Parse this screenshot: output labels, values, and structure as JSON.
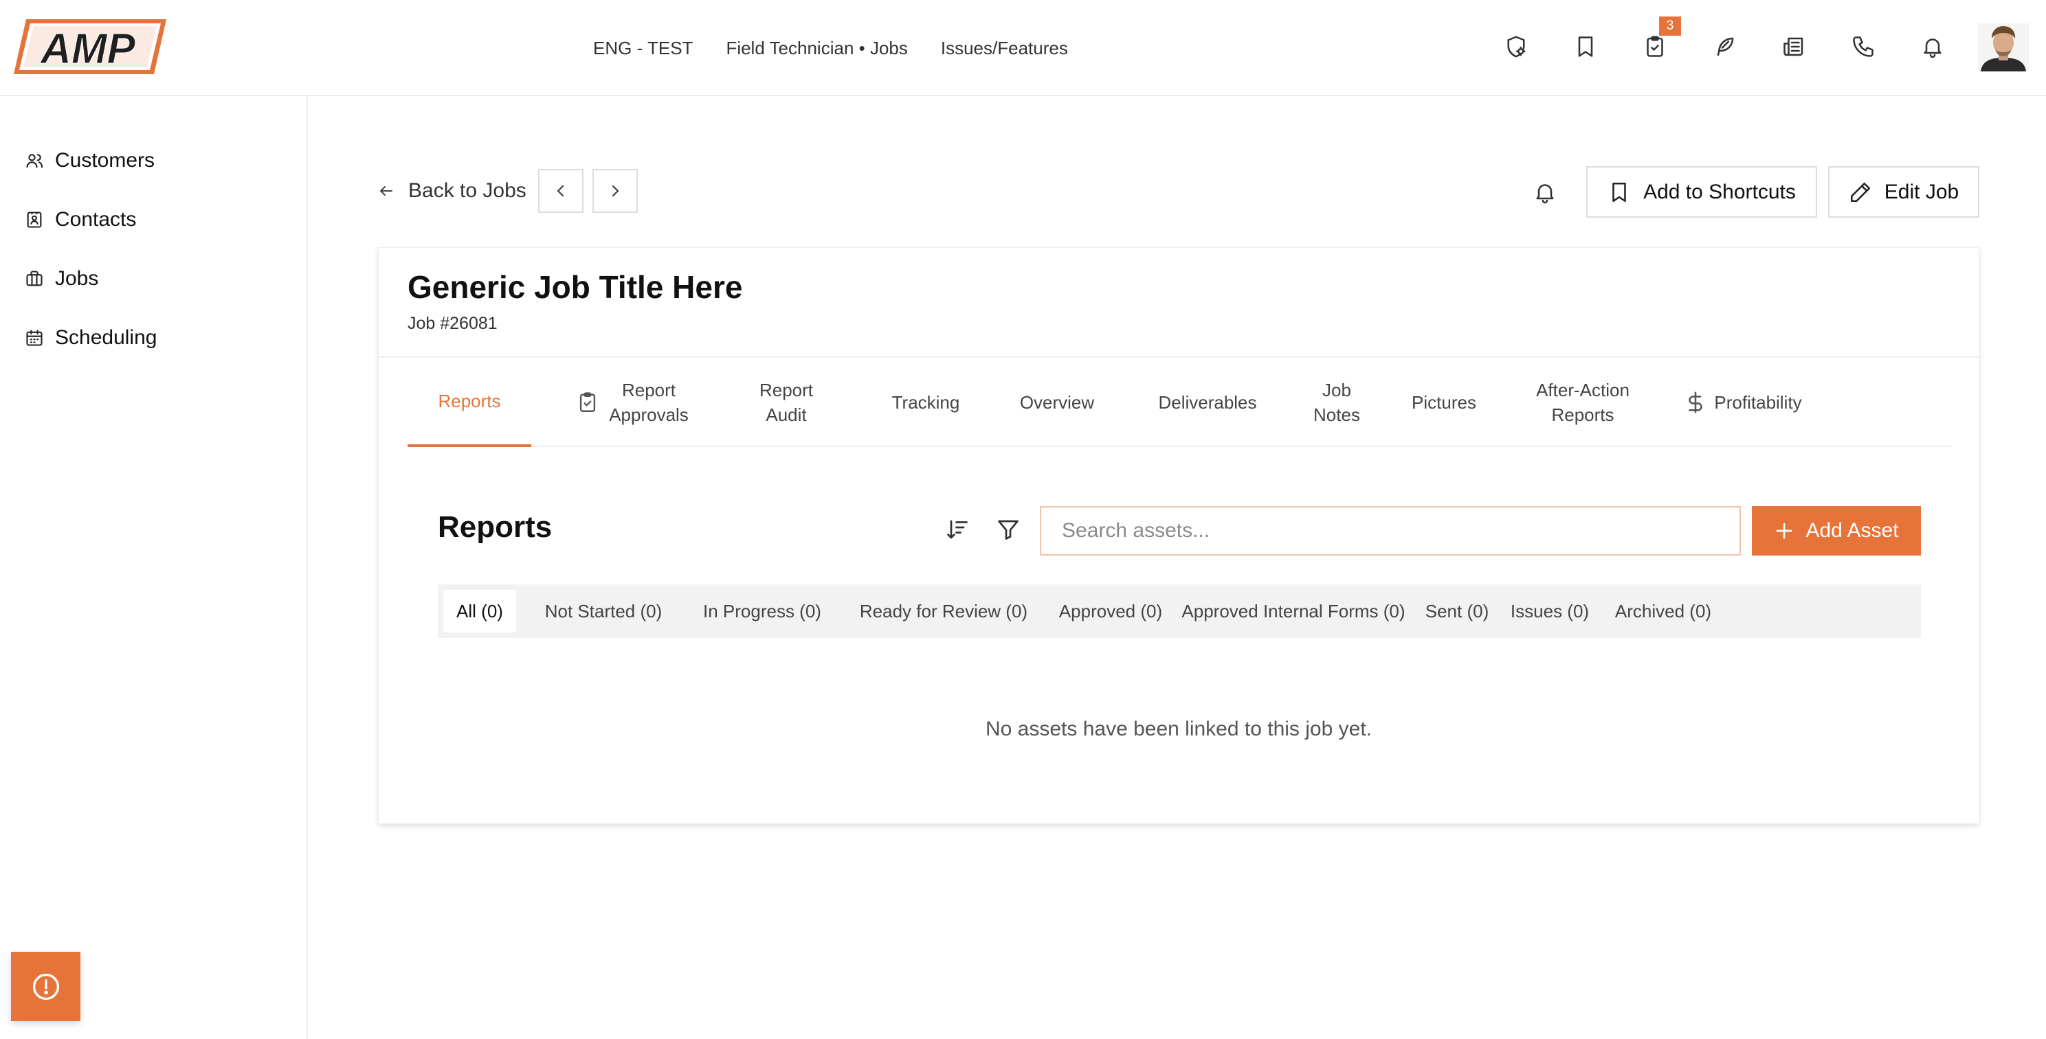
{
  "brand": {
    "logo_text": "AMP",
    "accent_color": "#e6743a"
  },
  "topnav": {
    "items": [
      "ENG - TEST",
      "Field Technician • Jobs",
      "Issues/Features"
    ]
  },
  "top_icons": {
    "items": [
      "shield-gear-icon",
      "bookmark-icon",
      "clipboard-check-icon",
      "feather-icon",
      "newspaper-icon",
      "phone-icon",
      "bell-icon"
    ],
    "task_badge_count": "3"
  },
  "sidebar": {
    "items": [
      {
        "label": "Customers",
        "icon": "users-icon"
      },
      {
        "label": "Contacts",
        "icon": "contact-card-icon"
      },
      {
        "label": "Jobs",
        "icon": "briefcase-icon"
      },
      {
        "label": "Scheduling",
        "icon": "calendar-icon"
      }
    ]
  },
  "header": {
    "back_label": "Back to Jobs",
    "shortcuts_label": "Add to Shortcuts",
    "edit_label": "Edit Job"
  },
  "job": {
    "title": "Generic Job Title Here",
    "number": "Job #26081"
  },
  "tabs": [
    {
      "line1": "Reports",
      "line2": "",
      "active": true
    },
    {
      "line1": "Report",
      "line2": "Approvals",
      "icon": "clipboard-check-icon"
    },
    {
      "line1": "Report",
      "line2": "Audit"
    },
    {
      "line1": "Tracking",
      "line2": ""
    },
    {
      "line1": "Overview",
      "line2": ""
    },
    {
      "line1": "Deliverables",
      "line2": ""
    },
    {
      "line1": "Job",
      "line2": "Notes"
    },
    {
      "line1": "Pictures",
      "line2": ""
    },
    {
      "line1": "After-Action",
      "line2": "Reports"
    },
    {
      "line1": "Profitability",
      "line2": "",
      "icon": "dollar-icon"
    }
  ],
  "reports": {
    "title": "Reports",
    "search_placeholder": "Search assets...",
    "search_value": "",
    "add_label": "Add Asset",
    "filters": [
      "All (0)",
      "Not Started (0)",
      "In Progress (0)",
      "Ready for Review (0)",
      "Approved (0)",
      "Approved Internal Forms (0)",
      "Sent (0)",
      "Issues (0)",
      "Archived (0)"
    ],
    "active_filter": "All (0)",
    "empty_message": "No assets have been linked to this job yet."
  }
}
